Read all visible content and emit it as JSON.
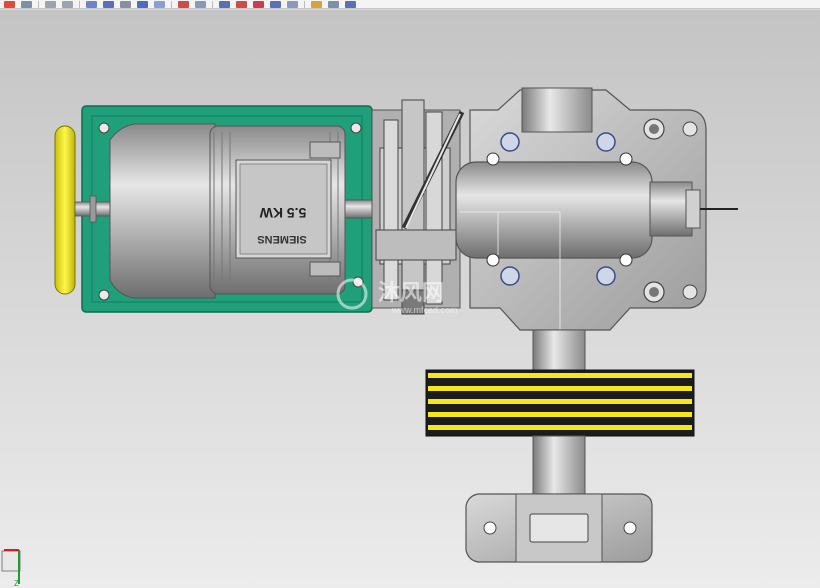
{
  "toolbar": {
    "icons": [
      "new-icon",
      "save-icon",
      "undo-icon",
      "redo-icon",
      "view-icon",
      "shade-icon",
      "wireframe-icon",
      "rotate-icon",
      "fit-icon",
      "zoom-icon",
      "pan-icon",
      "section-icon",
      "measure-icon",
      "snap-icon",
      "select-icon",
      "orient-icon",
      "render-icon",
      "layer-icon",
      "help-icon"
    ]
  },
  "model": {
    "motor_rating": "5.5 KW",
    "motor_brand": "SIEMENS",
    "watermark_main": "沐风网",
    "watermark_url": "www.mfcad.com"
  },
  "triad": {
    "axis_label": "Z"
  },
  "colors": {
    "frame_green": "#1fa07a",
    "handwheel_yellow": "#f2ea1a",
    "belt_yellow": "#f5e81a",
    "metal": "#a8a8a8"
  }
}
